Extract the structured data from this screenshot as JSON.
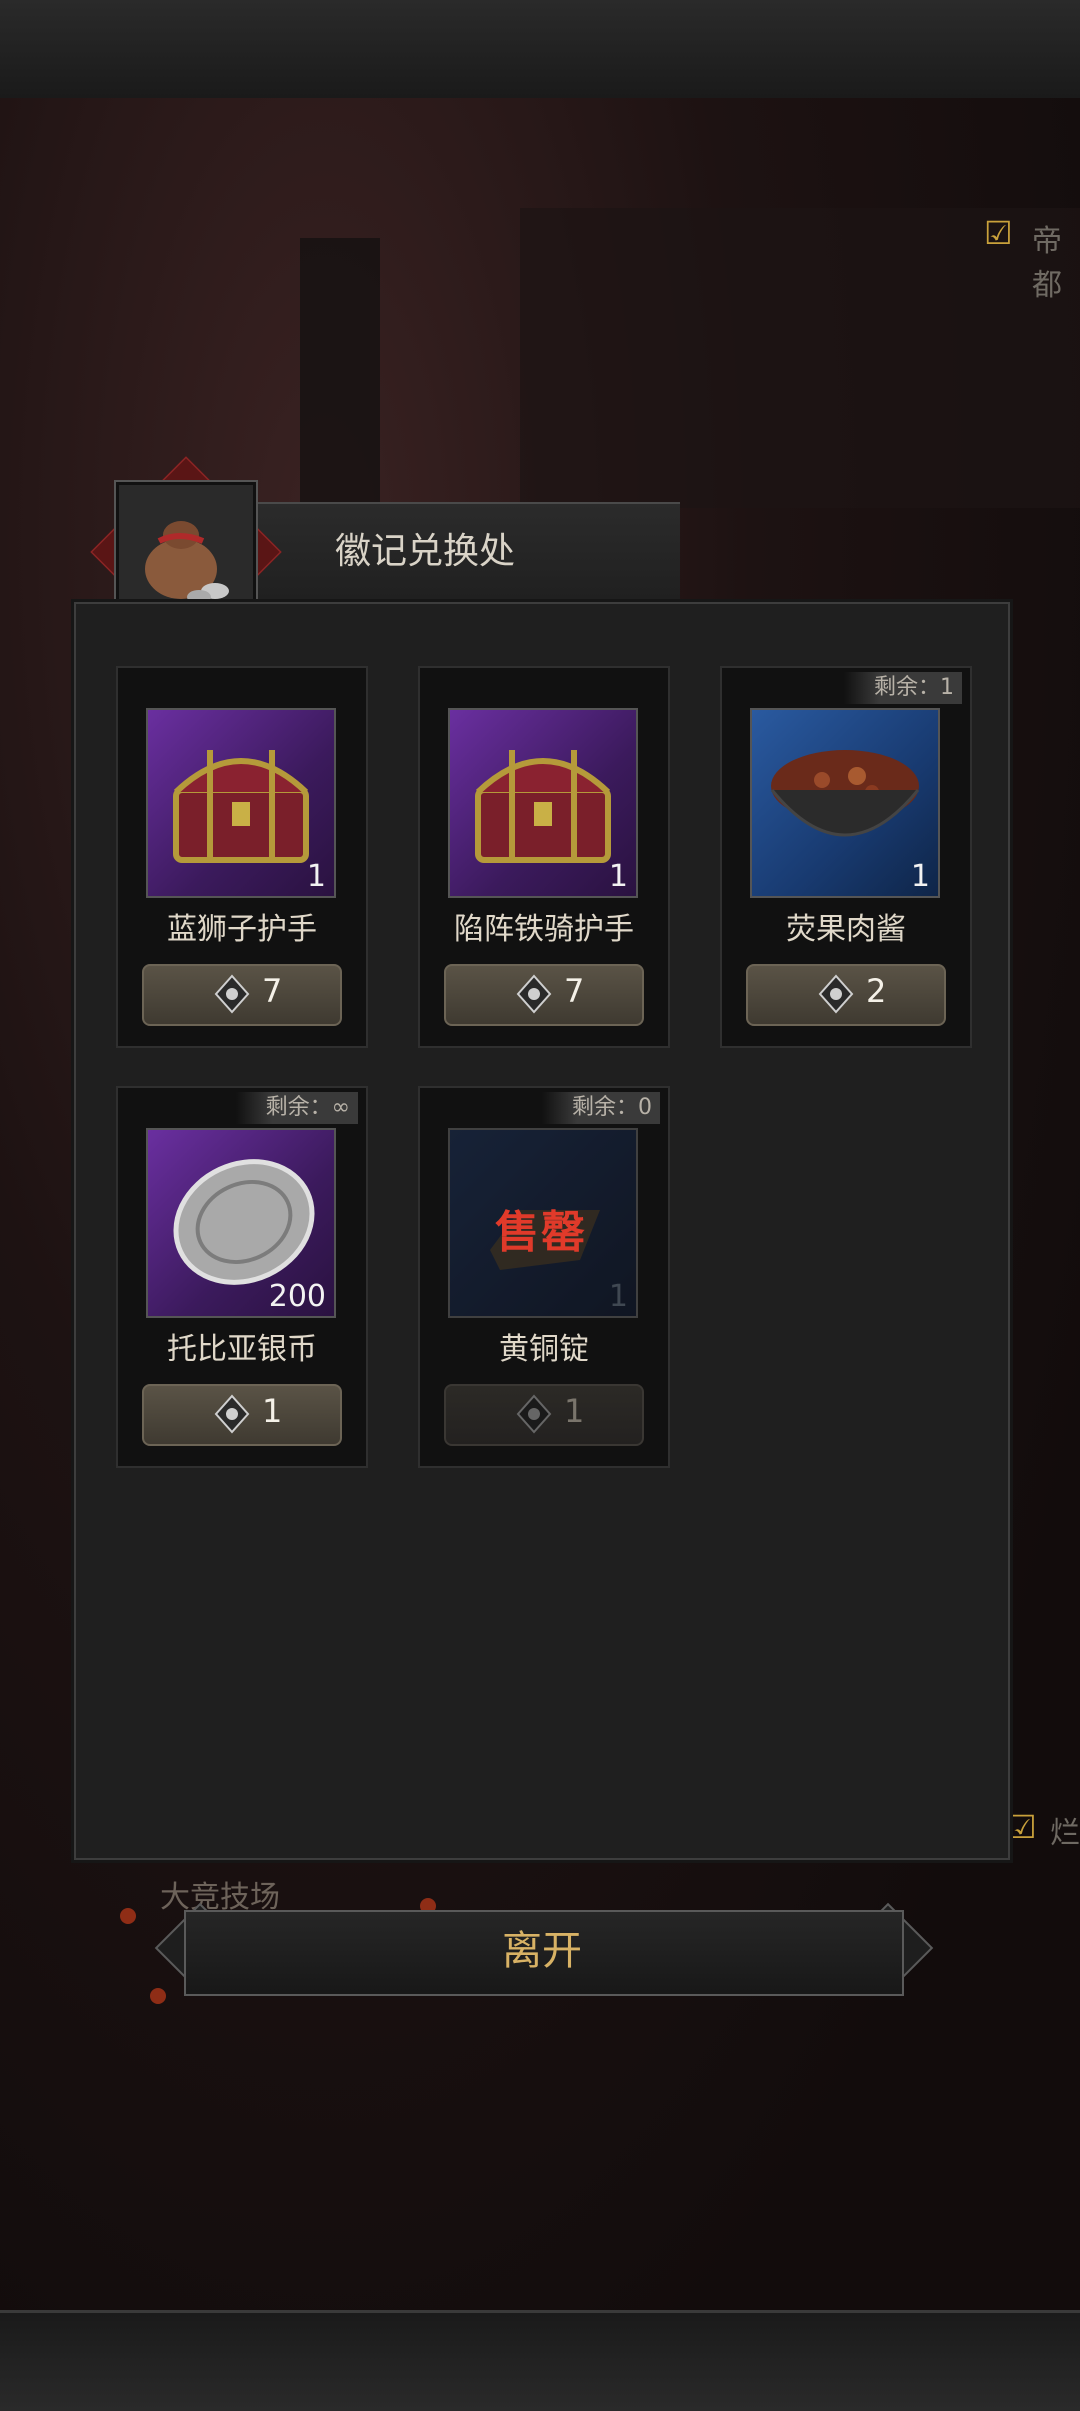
{
  "header": {
    "title": "徽记兑换处"
  },
  "background": {
    "side_top": "帝都",
    "side_bottom": "烂",
    "arena": "大竞技场"
  },
  "items": [
    {
      "name": "蓝狮子护手",
      "qty": "1",
      "cost": "7",
      "remain": "",
      "rarity": "purple",
      "icon": "treasure-chest-icon",
      "sold_out": false
    },
    {
      "name": "陷阵铁骑护手",
      "qty": "1",
      "cost": "7",
      "remain": "",
      "rarity": "purple",
      "icon": "treasure-chest-icon",
      "sold_out": false
    },
    {
      "name": "荧果肉酱",
      "qty": "1",
      "cost": "2",
      "remain": "剩余：1",
      "rarity": "blue",
      "icon": "meat-stew-bowl-icon",
      "sold_out": false
    },
    {
      "name": "托比亚银币",
      "qty": "200",
      "cost": "1",
      "remain": "剩余：∞",
      "rarity": "purple",
      "icon": "silver-coin-icon",
      "sold_out": false
    },
    {
      "name": "黄铜锭",
      "qty": "1",
      "cost": "1",
      "remain": "剩余：0",
      "rarity": "blue",
      "icon": "brass-ingot-icon",
      "sold_out": true,
      "sold_out_label": "售罄"
    }
  ],
  "footer": {
    "leave_label": "离开"
  },
  "colors": {
    "accent_gold": "#d8b265",
    "purple_frame": "#6a2fa0",
    "blue_frame": "#2a5aa0",
    "soldout_red": "#e03a2a"
  }
}
